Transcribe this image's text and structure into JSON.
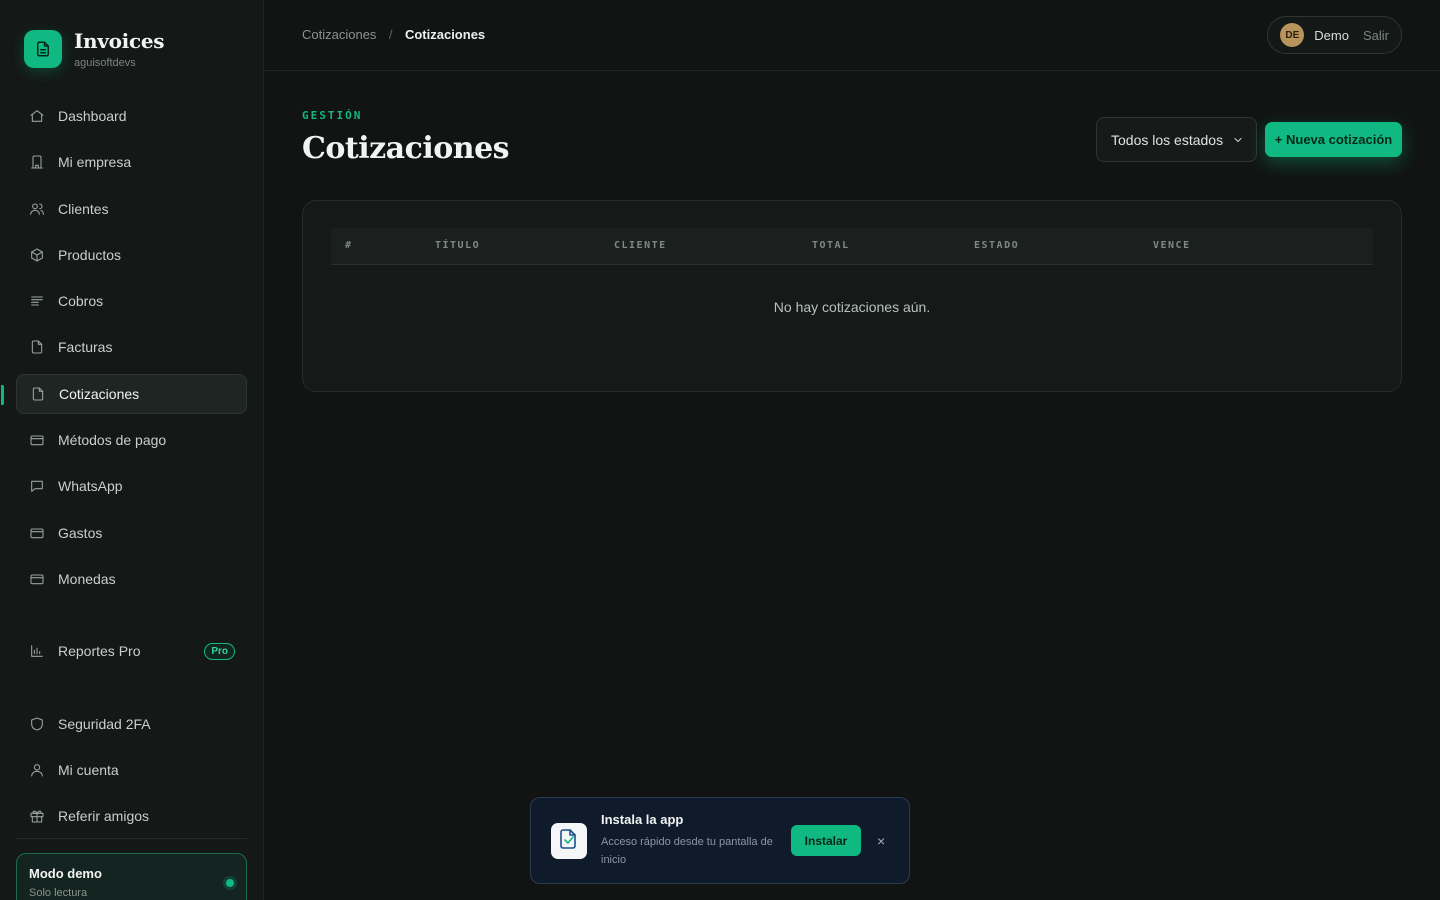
{
  "brand": {
    "title": "Invoices",
    "subtitle": "aguisoftdevs"
  },
  "sidebar": {
    "items": [
      {
        "label": "Dashboard",
        "icon": "home-icon"
      },
      {
        "label": "Mi empresa",
        "icon": "building-icon"
      },
      {
        "label": "Clientes",
        "icon": "users-icon"
      },
      {
        "label": "Productos",
        "icon": "box-icon"
      },
      {
        "label": "Cobros",
        "icon": "list-icon"
      },
      {
        "label": "Facturas",
        "icon": "file-icon"
      },
      {
        "label": "Cotizaciones",
        "icon": "file-icon",
        "active": true
      },
      {
        "label": "Métodos de pago",
        "icon": "card-icon"
      },
      {
        "label": "WhatsApp",
        "icon": "chat-icon"
      },
      {
        "label": "Gastos",
        "icon": "card-icon"
      },
      {
        "label": "Monedas",
        "icon": "card-icon"
      }
    ],
    "pro_item": {
      "label": "Reportes Pro",
      "badge": "Pro",
      "icon": "bar-chart-icon"
    },
    "bottom_items": [
      {
        "label": "Seguridad 2FA",
        "icon": "shield-icon"
      },
      {
        "label": "Mi cuenta",
        "icon": "user-icon"
      },
      {
        "label": "Referir amigos",
        "icon": "gift-icon"
      }
    ],
    "demo": {
      "title": "Modo demo",
      "subtitle": "Solo lectura"
    }
  },
  "header": {
    "breadcrumb": [
      "Cotizaciones",
      "Cotizaciones"
    ],
    "breadcrumb_separator": "/",
    "user": {
      "initials": "DE",
      "name": "Demo",
      "logout_label": "Salir"
    }
  },
  "page": {
    "eyebrow": "GESTIÓN",
    "title": "Cotizaciones",
    "filter_select": "Todos los estados",
    "new_button": "+ Nueva cotización"
  },
  "table": {
    "columns": [
      "#",
      "TÍTULO",
      "CLIENTE",
      "TOTAL",
      "ESTADO",
      "VENCE"
    ],
    "empty_message": "No hay cotizaciones aún."
  },
  "install_toast": {
    "title": "Instala la app",
    "subtitle": "Acceso rápido desde tu pantalla de inicio",
    "install_label": "Instalar",
    "close_label": "×"
  },
  "colors": {
    "accent": "#10b981",
    "background": "#111413",
    "sidebar": "#141817",
    "toast_bg": "#0f1a2a"
  }
}
